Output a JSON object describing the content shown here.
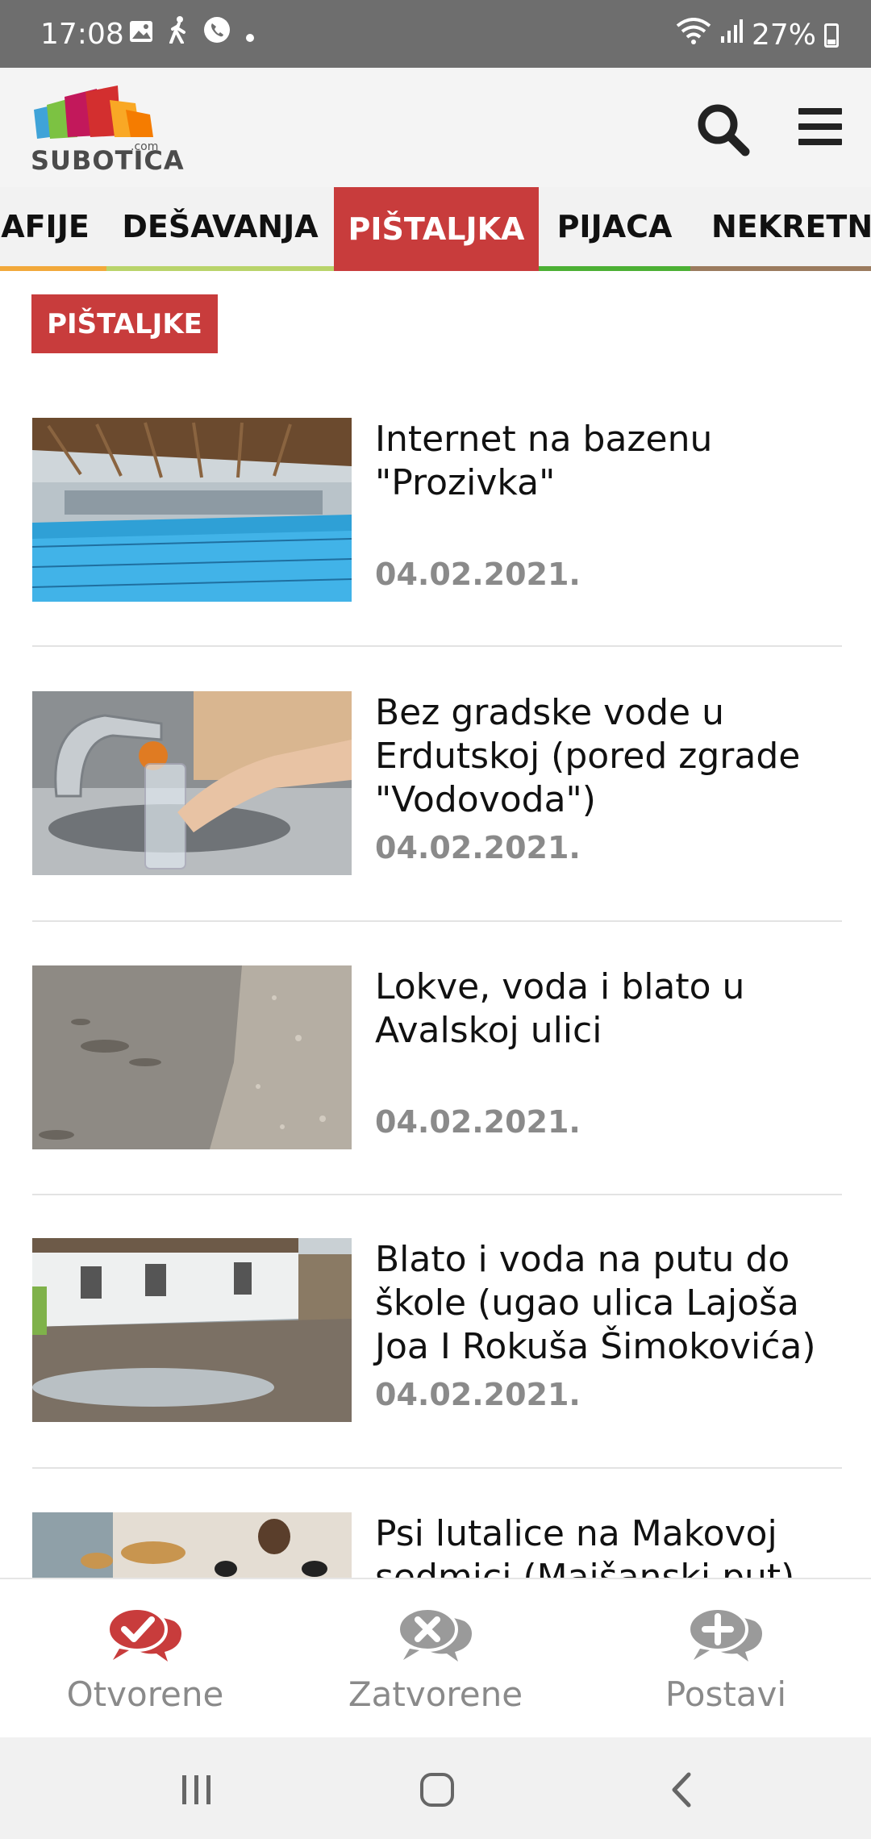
{
  "status_bar": {
    "time": "17:08",
    "battery": "27%",
    "icons": [
      "image-icon",
      "walking-icon",
      "phone-icon",
      "dot-icon",
      "wifi-icon",
      "signal-icon",
      "battery-icon"
    ]
  },
  "header": {
    "logo_text": "SUBOTICA",
    "logo_suffix": ".com",
    "search_icon": "search-icon",
    "menu_icon": "menu-icon"
  },
  "tabs": [
    {
      "label": "AFIJE",
      "active": false,
      "color": "#f2a93b"
    },
    {
      "label": "DEŠAVANJA",
      "active": false,
      "color": "#b9d46b"
    },
    {
      "label": "PIŠTALJKA",
      "active": true,
      "color": "#c83c3c"
    },
    {
      "label": "PIJACA",
      "active": false,
      "color": "#4cb034"
    },
    {
      "label": "NEKRETNI",
      "active": false,
      "color": "#9b7b5e"
    }
  ],
  "section": {
    "label": "PIŠTALJKE"
  },
  "articles": [
    {
      "title": "Internet na bazenu \"Prozivka\"",
      "date": "04.02.2021."
    },
    {
      "title": "Bez gradske vode u Erdutskoj (pored zgrade \"Vodovoda\")",
      "date": "04.02.2021."
    },
    {
      "title": "Lokve, voda i blato u Avalskoj ulici",
      "date": "04.02.2021."
    },
    {
      "title": "Blato i voda na putu do škole (ugao ulica Lajoša Joa I Rokuša Šimokovića)",
      "date": "04.02.2021."
    },
    {
      "title": "Psi lutalice na Makovoj sedmici (Majšanski put)",
      "date": ""
    }
  ],
  "actions": [
    {
      "label": "Otvorene",
      "icon": "chat-check-icon",
      "color": "#c83c3c"
    },
    {
      "label": "Zatvorene",
      "icon": "chat-x-icon",
      "color": "#9a9a9a"
    },
    {
      "label": "Postavi",
      "icon": "chat-plus-icon",
      "color": "#9a9a9a"
    }
  ],
  "colors": {
    "accent": "#c83c3c",
    "date_gray": "#8a8a8a"
  }
}
